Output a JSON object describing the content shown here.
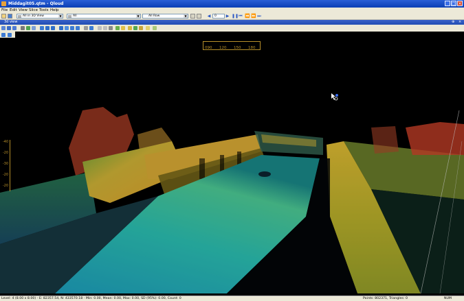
{
  "window": {
    "title": "Middagit05.qtm - Qloud"
  },
  "menu": [
    "File",
    "Edit",
    "View",
    "Slice",
    "Tools",
    "Help"
  ],
  "toolbar": {
    "view_combo": "All in 3D View",
    "layer_combo": "All",
    "mode_combo": "All Row",
    "frame_value": "0"
  },
  "panel": {
    "title": "3d view"
  },
  "compass": {
    "labels": [
      "090",
      "120",
      "150",
      "180"
    ]
  },
  "depth_scale": {
    "labels": [
      "-40",
      "-20",
      "-30",
      "-20",
      "-20"
    ]
  },
  "status": {
    "left": "Level: 4 (8.00 x 8.00) - E: 82357.54, N: 433570.18 - Min: 0.00, Mean: 0.00, Max: 0.00, SD (95%): 0.00, Count: 0",
    "right": "Points: 802371, Triangles: 0",
    "num": "NUM"
  },
  "colors": {
    "titlebar": "#0b3fb5",
    "chrome": "#ece9d8",
    "scale": "#b8902a"
  },
  "icons": [
    "qloud-logo-icon",
    "minimize-icon",
    "maximize-icon",
    "close-icon",
    "cursor-icon"
  ]
}
